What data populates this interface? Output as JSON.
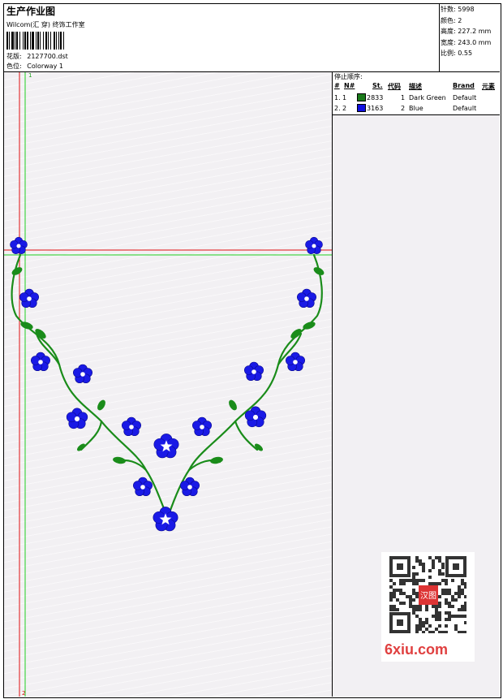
{
  "header": {
    "title": "生产作业图",
    "company": "Wilcom(汇 穿) 终饰工作室",
    "design_label": "花版:",
    "design_value": "2127700.dst",
    "colorway_label": "色位:",
    "colorway_value": "Colorway 1"
  },
  "stats": [
    {
      "label": "针数:",
      "value": "5998"
    },
    {
      "label": "颜色:",
      "value": "2"
    },
    {
      "label": "高度:",
      "value": "227.2 mm"
    },
    {
      "label": "宽度:",
      "value": "243.0 mm"
    },
    {
      "label": "比例:",
      "value": "0.55"
    }
  ],
  "stop_sequence": {
    "title": "停止顺序:",
    "columns": [
      "#",
      "N#",
      "St.",
      "代码",
      "描述",
      "Brand",
      "元素"
    ],
    "rows": [
      {
        "num": "1.",
        "n": "1",
        "st": "2833",
        "code": "1",
        "desc": "Dark Green",
        "brand": "Default",
        "color": "#1a7a1a"
      },
      {
        "num": "2.",
        "n": "2",
        "st": "3163",
        "code": "2",
        "desc": "Blue",
        "brand": "Default",
        "color": "#1010e0"
      }
    ]
  },
  "guides": {
    "v1": "1",
    "v2": "2"
  },
  "watermark": {
    "text": "6xiu.com",
    "stamp": "汉图"
  },
  "colors": {
    "thread_green": "#1a8c1a",
    "thread_blue": "#1a1ae6",
    "guide_red": "#e01010",
    "guide_green": "#20d020"
  }
}
